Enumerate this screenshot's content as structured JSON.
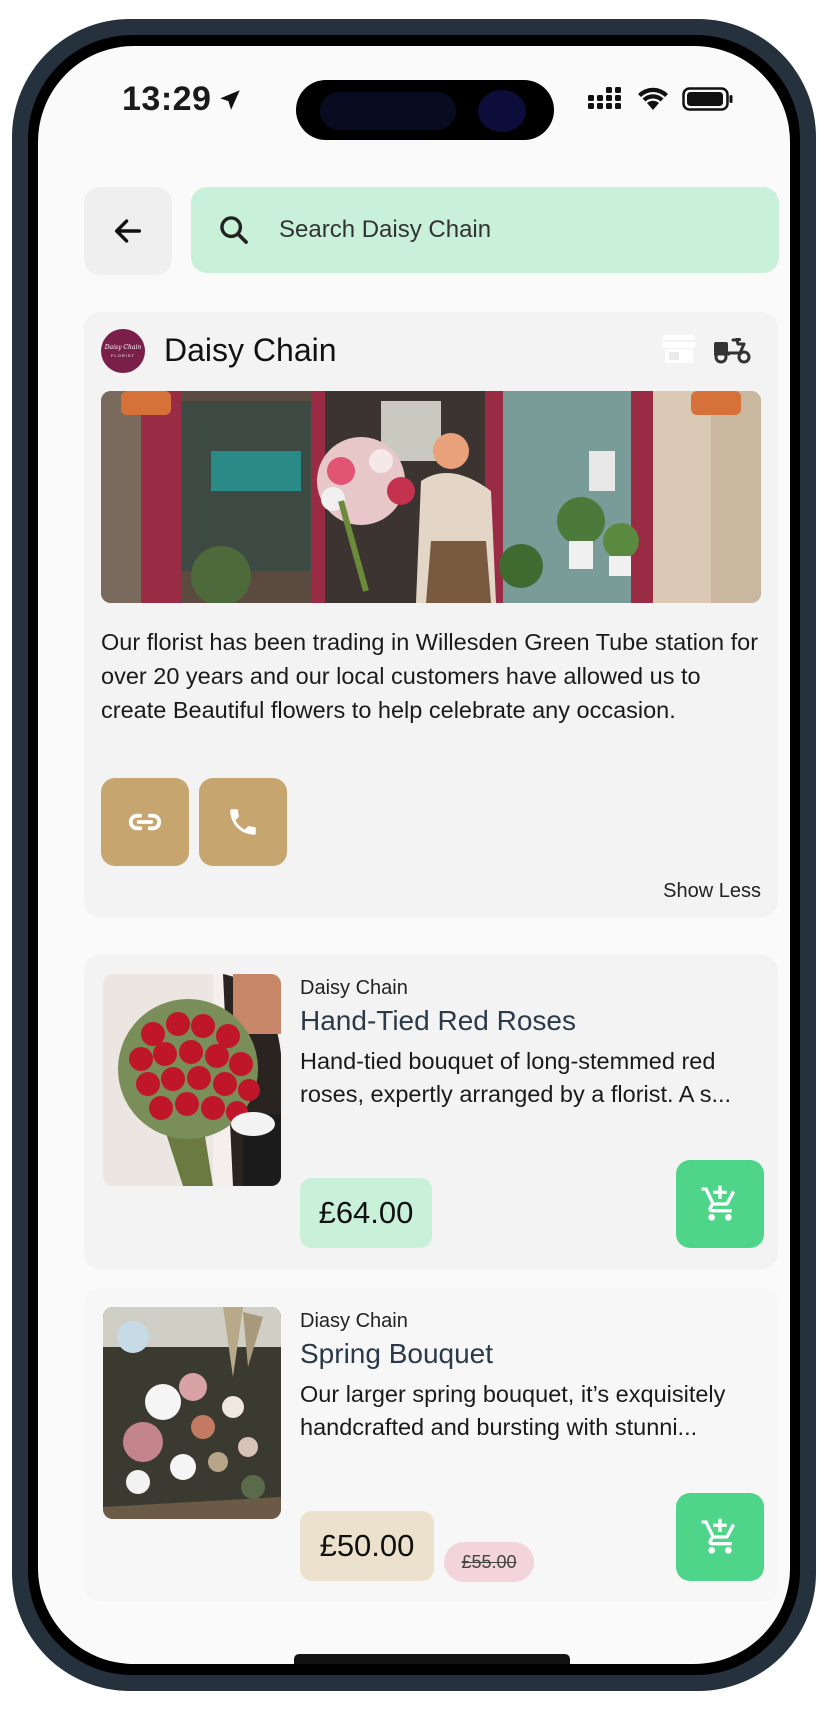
{
  "status_bar": {
    "time": "13:29"
  },
  "search": {
    "placeholder": "Search Daisy Chain"
  },
  "store": {
    "name": "Daisy Chain",
    "logo_text": "Daisy Chain",
    "logo_subtext": "FLORIST",
    "description": "Our florist has been trading in Willesden Green Tube station for over 20 years and our local customers have allowed us to create Beautiful flowers to help celebrate any occasion.",
    "show_less_label": "Show Less",
    "icons": [
      "storefront-icon",
      "delivery-scooter-icon",
      "link-icon",
      "phone-icon"
    ]
  },
  "products": [
    {
      "store": "Daisy Chain",
      "title": "Hand-Tied Red Roses",
      "description": "Hand-tied bouquet of long-stemmed red roses, expertly arranged by a florist. A s...",
      "price": "£64.00"
    },
    {
      "store": "Diasy Chain",
      "title": "Spring Bouquet",
      "description": "Our larger spring bouquet, it’s exquisitely handcrafted and bursting with stunni...",
      "price": "£50.00",
      "old_price": "£55.00"
    }
  ],
  "colors": {
    "search_bg": "#c9f0d9",
    "accent_gold": "#c6a56f",
    "cart_green": "#4ed58a",
    "price_green": "#c9f0d9",
    "price_beige": "#ebe1cc",
    "old_price_pink": "#f2d4da",
    "frame": "#25313d"
  }
}
